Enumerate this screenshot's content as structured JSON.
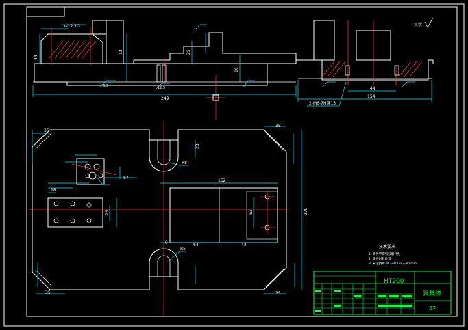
{
  "drawing": {
    "material": "HT200",
    "part_name": "夹具体",
    "sheet_size": "A2",
    "roughness_note": "其余",
    "hole_callout": "2-M6-7H深13",
    "tech_req_title": "技术要求",
    "tech_req": [
      "1. 铸件不得有砂眼气孔",
      "2. 铸件时效处理",
      "3. 未注倒角 MLGB1184—80 mm."
    ]
  },
  "dims": {
    "d_249": "249",
    "d_154": "154",
    "d_44": "44",
    "d_152": "152",
    "d_270": "270",
    "d_35a": "35",
    "d_35b": "35",
    "d_35c": "35",
    "d_35d": "35",
    "d_18": "18",
    "d_42": "42",
    "d_64": "64",
    "d_87": "87",
    "d_9": "9",
    "d_16": "16",
    "d_13": "13",
    "d_25": "25",
    "d_26": "26",
    "d_53": "53",
    "d_23": "23",
    "d_R8": "R8",
    "d_R5": "R5",
    "d_6_3": "6.3",
    "d_12_5": "12.5",
    "d_phi": "Φ12.7G"
  }
}
